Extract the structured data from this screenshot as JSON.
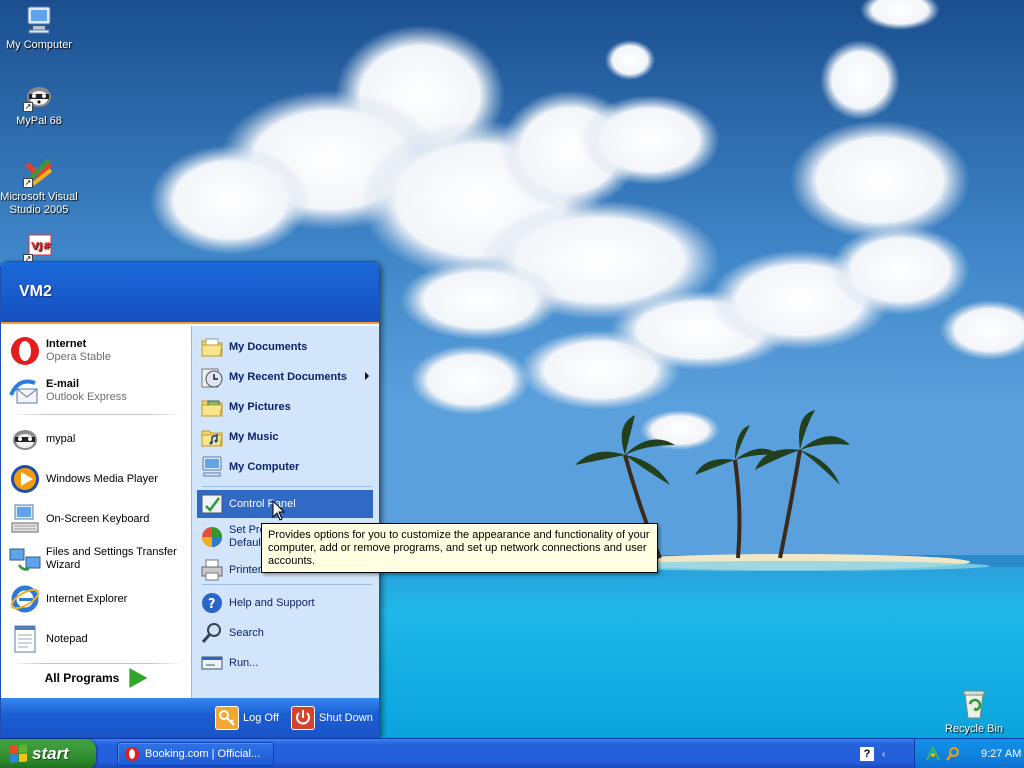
{
  "desktop": {
    "icons": [
      {
        "label": "My Computer",
        "icon": "my-computer-icon"
      },
      {
        "label": "MyPal 68",
        "icon": "mypal-icon"
      },
      {
        "label": "Microsoft Visual Studio 2005",
        "icon": "visual-studio-icon"
      },
      {
        "label": "",
        "icon": "vjsharp-icon"
      },
      {
        "label": "Recycle Bin",
        "icon": "recycle-bin-icon"
      }
    ]
  },
  "start_menu": {
    "user_name": "VM2",
    "pinned": [
      {
        "title": "Internet",
        "subtitle": "Opera Stable",
        "icon": "opera-icon"
      },
      {
        "title": "E-mail",
        "subtitle": "Outlook Express",
        "icon": "outlook-express-icon"
      }
    ],
    "recent": [
      {
        "label": "mypal",
        "icon": "mypal-icon"
      },
      {
        "label": "Windows Media Player",
        "icon": "media-player-icon"
      },
      {
        "label": "On-Screen Keyboard",
        "icon": "keyboard-icon"
      },
      {
        "label": "Files and Settings Transfer Wizard",
        "icon": "transfer-wizard-icon"
      },
      {
        "label": "Internet Explorer",
        "icon": "internet-explorer-icon"
      },
      {
        "label": "Notepad",
        "icon": "notepad-icon"
      }
    ],
    "all_programs_label": "All Programs",
    "places": [
      {
        "label": "My Documents",
        "icon": "folder-icon",
        "bold": true
      },
      {
        "label": "My Recent Documents",
        "icon": "recent-documents-icon",
        "bold": true,
        "submenu": true
      },
      {
        "label": "My Pictures",
        "icon": "pictures-folder-icon",
        "bold": true
      },
      {
        "label": "My Music",
        "icon": "music-folder-icon",
        "bold": true
      },
      {
        "label": "My Computer",
        "icon": "my-computer-icon",
        "bold": true
      }
    ],
    "system": [
      {
        "label": "Control Panel",
        "icon": "control-panel-icon",
        "highlighted": true
      },
      {
        "label": "Set Program Access and Defaults",
        "visible_line1": "Set Pro",
        "visible_line2": "Default",
        "icon": "set-defaults-icon"
      },
      {
        "label": "Printers",
        "visible": "Printers",
        "icon": "printer-icon"
      }
    ],
    "help": [
      {
        "label": "Help and Support",
        "icon": "help-icon"
      },
      {
        "label": "Search",
        "icon": "search-icon"
      },
      {
        "label": "Run...",
        "icon": "run-icon"
      }
    ],
    "footer": {
      "log_off_label": "Log Off",
      "shut_down_label": "Shut Down"
    }
  },
  "tooltip": {
    "text": "Provides options for you to customize the appearance and functionality of your computer, add or remove programs, and set up network connections and user accounts."
  },
  "taskbar": {
    "start_label": "start",
    "tasks": [
      {
        "label": "Booking.com | Official...",
        "icon": "opera-icon"
      }
    ],
    "clock": "9:27 AM"
  },
  "colors": {
    "taskbar_blue": "#245ddb",
    "start_green": "#3c9a3a",
    "highlight": "#316ac5",
    "tooltip_bg": "#ffffe1",
    "right_panel": "#d3e5fa"
  }
}
